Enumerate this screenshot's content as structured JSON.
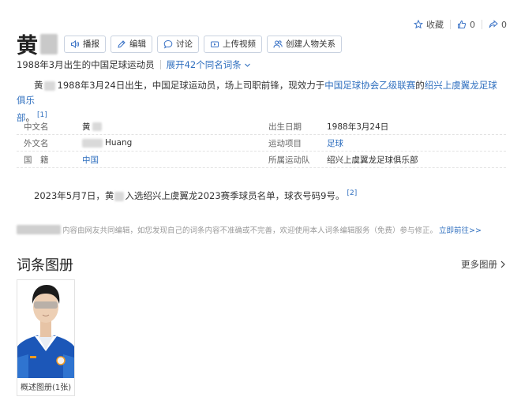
{
  "top_actions": {
    "favorite_label": "收藏",
    "like_count": "0",
    "share_count": "0"
  },
  "header": {
    "title": "黄",
    "buttons": [
      {
        "label": "播报",
        "icon": "speaker-icon"
      },
      {
        "label": "编辑",
        "icon": "pencil-icon"
      },
      {
        "label": "讨论",
        "icon": "chat-icon"
      },
      {
        "label": "上传视频",
        "icon": "video-icon"
      },
      {
        "label": "创建人物关系",
        "icon": "people-icon"
      }
    ]
  },
  "subtitle": {
    "description": "1988年3月出生的中国足球运动员",
    "expand_label": "展开42个同名词条"
  },
  "summary": {
    "name_start": "黄",
    "text": "1988年3月24日出生，中国足球运动员，场上司职前锋，现效力于",
    "league_link": "中国足球协会乙级联赛",
    "connector": "的",
    "club_link_1": "绍兴上虞翼龙足球俱乐",
    "club_link_2": "部",
    "end": "。",
    "ref": "[1]"
  },
  "info": {
    "rows": [
      {
        "k1": "中文名",
        "v1": "黄",
        "k2": "出生日期",
        "v2": "1988年3月24日"
      },
      {
        "k1": "外文名",
        "v1": "Huang",
        "k2": "运动项目",
        "v2": "足球"
      },
      {
        "k1": "国　籍",
        "v1": "中国",
        "k2": "所属运动队",
        "v2": "绍兴上虞翼龙足球俱乐部"
      }
    ]
  },
  "news": {
    "prefix": "2023年5月7日，黄",
    "text": "入选绍兴上虞翼龙2023赛季球员名单，球衣号码9号。",
    "ref": "[2]"
  },
  "disclaimer": {
    "text": "内容由网友共同编辑，如您发现自己的词条内容不准确或不完善，欢迎使用本人词条编辑服务（免费）参与修正。",
    "link": "立即前往>>"
  },
  "album": {
    "title": "词条图册",
    "more": "更多图册",
    "caption": "概述图册(1张)"
  },
  "colors": {
    "link": "#2f6fbf",
    "jersey": "#1c57b8",
    "border": "#c9d2e0"
  }
}
